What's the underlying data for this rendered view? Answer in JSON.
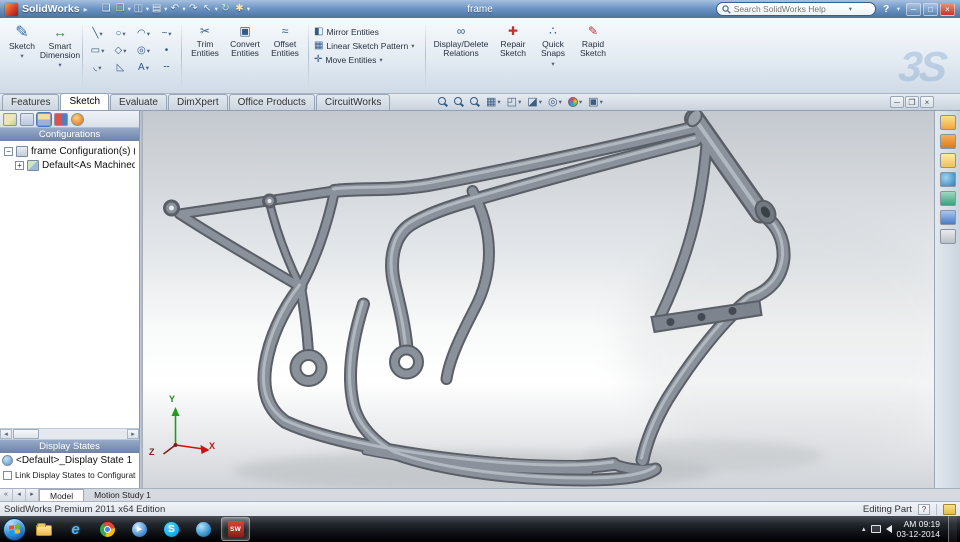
{
  "colors": {
    "titlebar_blue": "#6f97c6",
    "panel_header_blue": "#6c82a7",
    "model_gray": "#8b919a",
    "taskbar_black": "#0b0d10",
    "skype_blue": "#00aff0",
    "solidworks_red": "#b02a23"
  },
  "titlebar": {
    "brand": "SolidWorks",
    "doc_name": "frame",
    "search_placeholder": "Search SolidWorks Help",
    "help": "?"
  },
  "ribbon": {
    "sketch": "Sketch",
    "smart_dimension": "Smart Dimension",
    "trim": "Trim Entities",
    "convert": "Convert Entities",
    "offset": "Offset Entities",
    "mirror": "Mirror Entities",
    "linear_pattern": "Linear Sketch Pattern",
    "move": "Move Entities",
    "display_delete": "Display/Delete Relations",
    "repair": "Repair Sketch",
    "quick_snaps": "Quick Snaps",
    "rapid": "Rapid Sketch"
  },
  "tabs": {
    "items": [
      {
        "label": "Features"
      },
      {
        "label": "Sketch"
      },
      {
        "label": "Evaluate"
      },
      {
        "label": "DimXpert"
      },
      {
        "label": "Office Products"
      },
      {
        "label": "CircuitWorks"
      }
    ]
  },
  "panel": {
    "configurations_header": "Configurations",
    "config_root": "frame Configuration(s)  (Defa",
    "config_child": "Default<As Machined> [",
    "display_states_header": "Display States",
    "display_state": "<Default>_Display State 1",
    "link_label": "Link Display States to Configurations"
  },
  "viewport": {
    "triad": {
      "x": "X",
      "y": "Y",
      "z": "Z"
    }
  },
  "model_tabs": {
    "model": "Model",
    "motion": "Motion Study 1"
  },
  "statusbar": {
    "edition": "SolidWorks Premium 2011 x64 Edition",
    "mode": "Editing Part",
    "help": "?"
  },
  "taskbar": {
    "time": "AM 09:19",
    "date": "03-12-2014"
  },
  "watermark": "3S",
  "icons": {
    "menu_arrow": "▸",
    "dropdown": "▾",
    "new_doc": "❏",
    "open": "❒",
    "save": "◫",
    "print": "▤",
    "undo": "↶",
    "redo": "↷",
    "select": "↖",
    "rebuild": "↻",
    "options": "✱",
    "minimize": "─",
    "maximize": "□",
    "restore": "❐",
    "close": "×",
    "pencil": "✎",
    "dimension": "↔",
    "line": "╲",
    "circle": "○",
    "arc": "◠",
    "spline": "~",
    "rect": "▭",
    "polygon": "◇",
    "ellipse": "◎",
    "point": "•",
    "fillet": "◟",
    "chamfer": "◺",
    "text": "A",
    "construction": "╌",
    "trim": "✂",
    "convert": "▣",
    "offset": "≈",
    "mirror": "◧",
    "linear": "▦",
    "move": "✛",
    "disp_rel": "∞",
    "repair": "✚",
    "snaps": "∴",
    "rapid": "✎",
    "section": "▦",
    "orient": "◰",
    "style": "◪",
    "hideshow": "◎",
    "scene": "▣",
    "collapse": "−",
    "expand": "+",
    "left_arrow": "◂",
    "right_arrow": "▸",
    "nav_first": "«",
    "tray_arrow": "▴",
    "browser_e": "e",
    "play": "▶",
    "skype_s": "S",
    "sw_badge": "SW"
  }
}
